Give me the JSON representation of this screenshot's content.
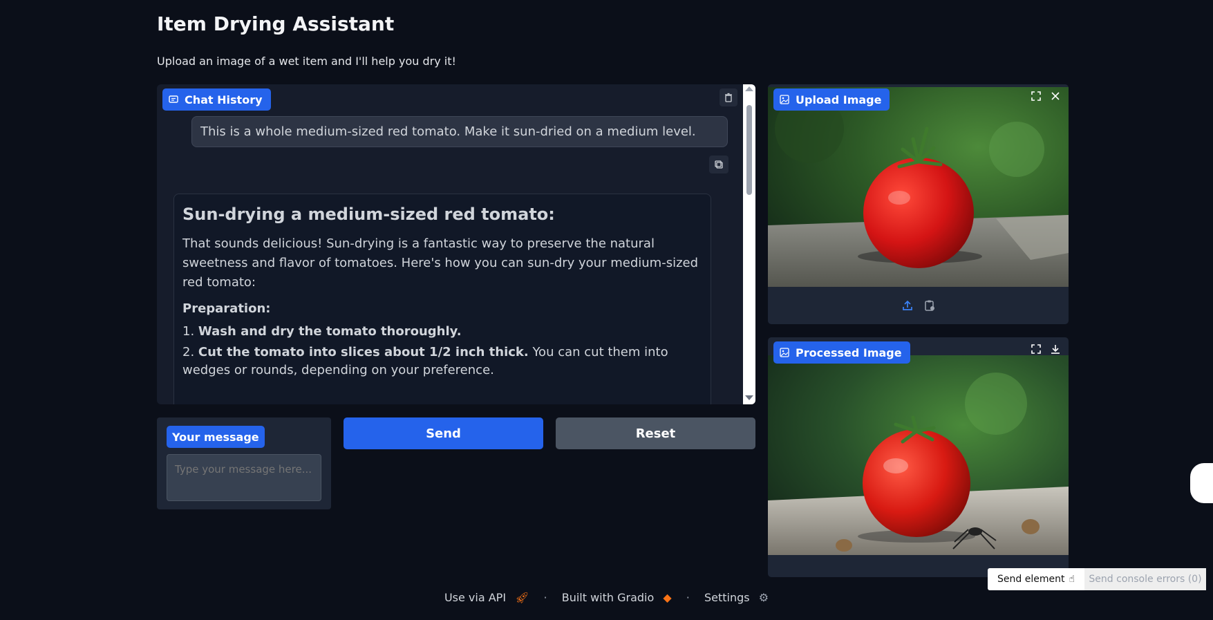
{
  "app": {
    "title": "Item Drying Assistant",
    "subtitle": "Upload an image of a wet item and I'll help you dry it!"
  },
  "chat": {
    "label": "Chat History",
    "user_message": "This is a whole medium-sized red tomato. Make it sun-dried on a medium level.",
    "bot": {
      "heading": "Sun-drying a medium-sized red tomato:",
      "intro": "That sounds delicious! Sun-drying is a fantastic way to preserve the natural sweetness and flavor of tomatoes. Here's how you can sun-dry your medium-sized red tomato:",
      "preparation_label": "Preparation:",
      "steps": [
        {
          "num": "1.",
          "bold": "Wash and dry the tomato thoroughly.",
          "rest": ""
        },
        {
          "num": "2.",
          "bold": "Cut the tomato into slices about 1/2 inch thick.",
          "rest": " You can cut them into wedges or rounds, depending on your preference."
        }
      ]
    }
  },
  "message_box": {
    "label": "Your message",
    "placeholder": "Type your message here..."
  },
  "buttons": {
    "send": "Send",
    "reset": "Reset"
  },
  "upload_image": {
    "label": "Upload Image"
  },
  "processed_image": {
    "label": "Processed Image"
  },
  "footer": {
    "api": "Use via API",
    "built": "Built with Gradio",
    "settings": "Settings"
  },
  "overlay": {
    "send_element": "Send element",
    "send_console": "Send console errors (0)"
  },
  "colors": {
    "background": "#0b0f19",
    "accent": "#2563eb",
    "panel": "#1e2636"
  }
}
